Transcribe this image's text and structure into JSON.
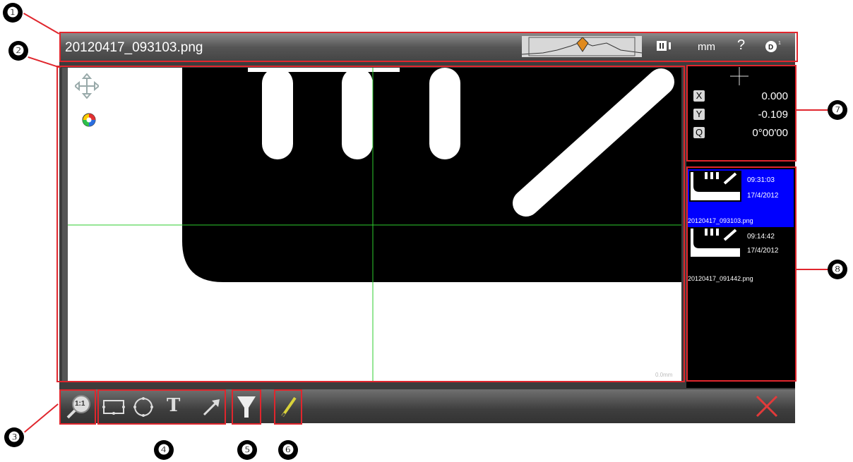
{
  "header": {
    "filename": "20120417_093103.png",
    "unit_label": "mm",
    "help_label": "?",
    "pause_icon": "pause-icon",
    "settings_icon": "dial-icon"
  },
  "callouts": [
    "❶",
    "❷",
    "❸",
    "❹",
    "❺",
    "❻",
    "❼",
    "❽"
  ],
  "viewer": {
    "pan_icon": "move-arrows-icon",
    "color_icon": "color-wheel-icon",
    "watermark": "0.0mm"
  },
  "coordinates": {
    "x_label": "X",
    "x_value": "0.000",
    "y_label": "Y",
    "y_value": "-0.109",
    "q_label": "Q",
    "q_value": "0°00'00"
  },
  "gallery": [
    {
      "time": "09:31:03",
      "date": "17/4/2012",
      "name": "20120417_093103.png",
      "selected": true
    },
    {
      "time": "09:14:42",
      "date": "17/4/2012",
      "name": "20120417_091442.png",
      "selected": false
    }
  ],
  "toolbar": {
    "zoom_label": "1:1",
    "text_tool_label": "T",
    "tools": [
      "zoom-1to1-button",
      "rectangle-tool",
      "circle-tool",
      "text-tool",
      "arrow-tool",
      "y-filter-tool",
      "pencil-tool"
    ]
  },
  "colors": {
    "selection": "#0000ff",
    "crosshair": "#2ecc2e",
    "highlight": "#e0262d",
    "close": "#e23a3a"
  }
}
